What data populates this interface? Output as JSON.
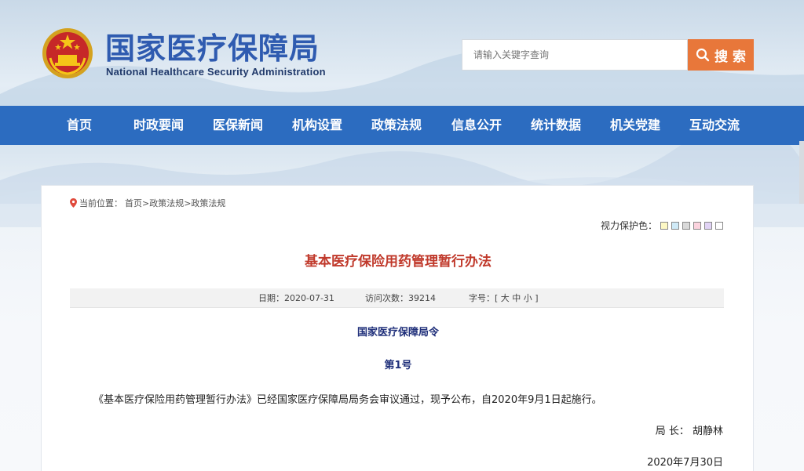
{
  "header": {
    "title": "国家医疗保障局",
    "subtitle": "National Healthcare Security Administration",
    "search_placeholder": "请输入关键字查询",
    "search_button": "搜 索"
  },
  "nav": {
    "items": [
      "首页",
      "时政要闻",
      "医保新闻",
      "机构设置",
      "政策法规",
      "信息公开",
      "统计数据",
      "机关党建",
      "互动交流"
    ]
  },
  "breadcrumb": {
    "label": "当前位置：",
    "path": "首页>政策法规>政策法规"
  },
  "vision": {
    "label": "视力保护色：",
    "swatches": [
      "#fdf8c4",
      "#cfeaf7",
      "#d9d9d9",
      "#fbd3de",
      "#e1d3f5",
      "#ffffff"
    ]
  },
  "article": {
    "title": "基本医疗保险用药管理暂行办法",
    "date_label": "日期：2020-07-31",
    "visits_label": "访问次数：39214",
    "font_label": "字号：[ 大 中 小 ]",
    "order_title": "国家医疗保障局令",
    "order_number": "第1号",
    "paragraph": "《基本医疗保险用药管理暂行办法》已经国家医疗保障局局务会审议通过，现予公布，自2020年9月1日起施行。",
    "signer": "局 长：  胡静林",
    "sign_date": "2020年7月30日"
  },
  "colors": {
    "nav_bg": "#2c6cc0",
    "search_btn": "#e8773a",
    "title_red": "#c0392b",
    "order_blue": "#1f2f7a"
  }
}
